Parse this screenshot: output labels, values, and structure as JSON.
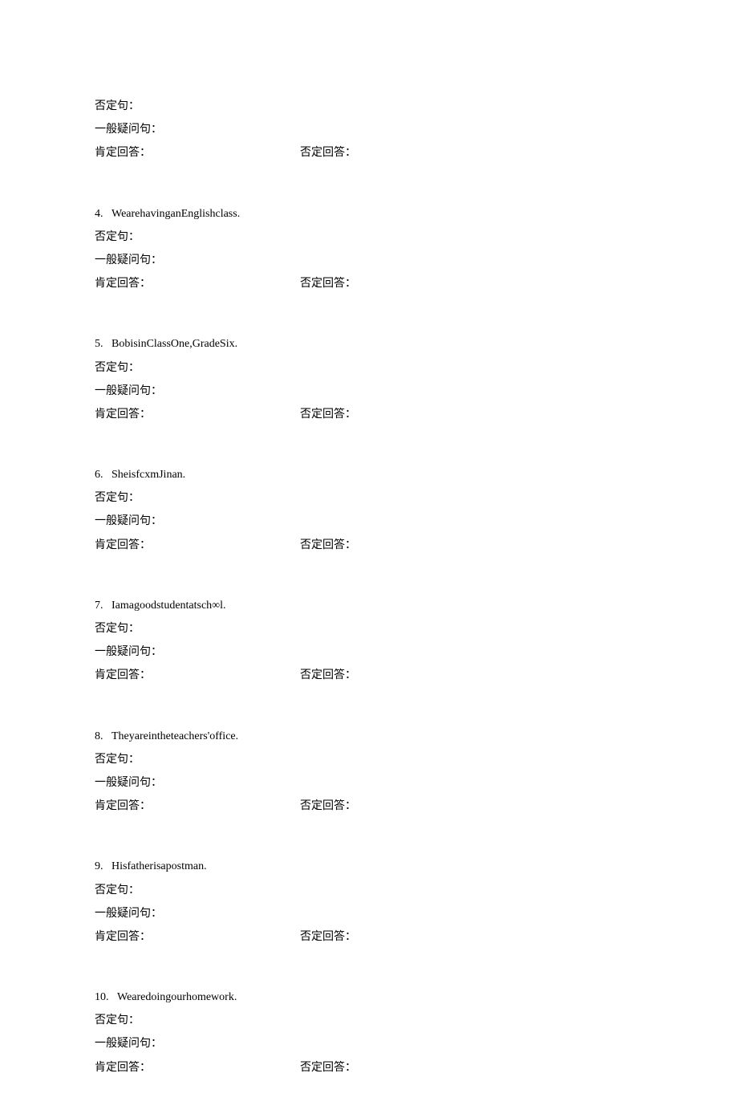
{
  "labels": {
    "negative": "否定句：",
    "general_q": "一般疑问句：",
    "affirm_ans": "肯定回答：",
    "neg_ans": "否定回答："
  },
  "items": [
    {
      "num": "",
      "text": ""
    },
    {
      "num": "4.",
      "text": "WearehavinganEnglishclass."
    },
    {
      "num": "5.",
      "text": "BobisinClassOne,GradeSix."
    },
    {
      "num": "6.",
      "text": "SheisfcxmJinan."
    },
    {
      "num": "7.",
      "text": "Iamagoodstudentatsch∞l."
    },
    {
      "num": "8.",
      "text": "Theyareintheteachers'office."
    },
    {
      "num": "9.",
      "text": "Hisfatherisapostman."
    },
    {
      "num": "10.",
      "text": "Wearedoingourhomework."
    }
  ]
}
